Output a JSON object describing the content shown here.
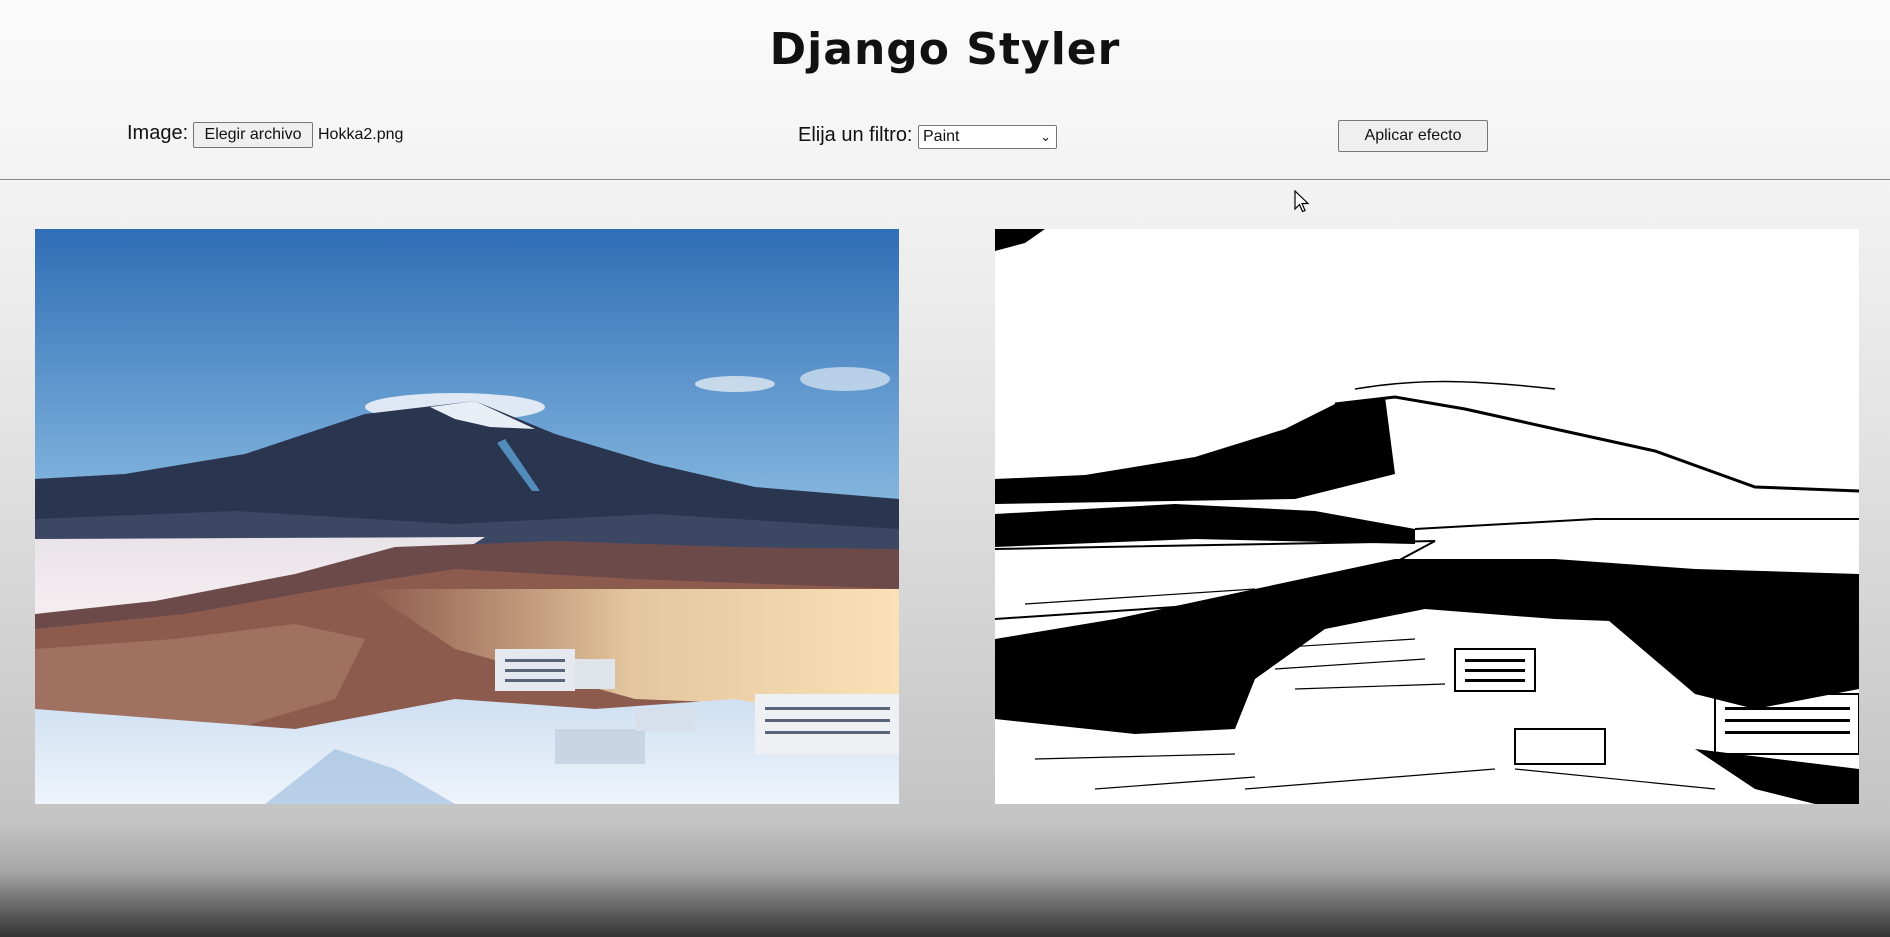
{
  "header": {
    "title": "Django Styler"
  },
  "form": {
    "image_label": "Image:",
    "file_button_label": "Elegir archivo",
    "file_name": "Hokka2.png",
    "filter_label": "Elija un filtro:",
    "filter_selected": "Paint",
    "apply_button_label": "Aplicar efecto"
  },
  "images": {
    "original_description_icon": "photo-original",
    "styled_description_icon": "photo-styled"
  },
  "colors": {
    "sky_top": "#2f6db5",
    "sky_bottom": "#cfe6f2",
    "mountain": "#2a3550",
    "snow": "#e8eef6",
    "trees": "#8d5a4e"
  }
}
